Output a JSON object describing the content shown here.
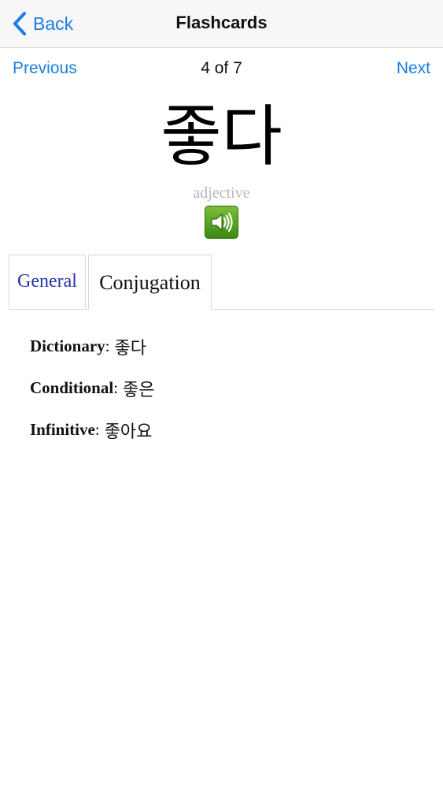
{
  "navbar": {
    "back_label": "Back",
    "title": "Flashcards"
  },
  "pager": {
    "previous_label": "Previous",
    "position": "4 of 7",
    "next_label": "Next"
  },
  "card": {
    "word": "좋다",
    "part_of_speech": "adjective",
    "audio_icon": "speaker-icon"
  },
  "tabs": [
    {
      "label": "General",
      "active": false
    },
    {
      "label": "Conjugation",
      "active": true
    }
  ],
  "conjugation": [
    {
      "label": "Dictionary",
      "separator": ":",
      "value": "좋다"
    },
    {
      "label": "Conditional",
      "separator": ":",
      "value": "좋은"
    },
    {
      "label": "Infinitive",
      "separator": ":",
      "value": "좋아요"
    }
  ],
  "colors": {
    "link": "#1a7ee5",
    "tab_inactive": "#2233aa",
    "audio_button": "#4f9a1f"
  }
}
